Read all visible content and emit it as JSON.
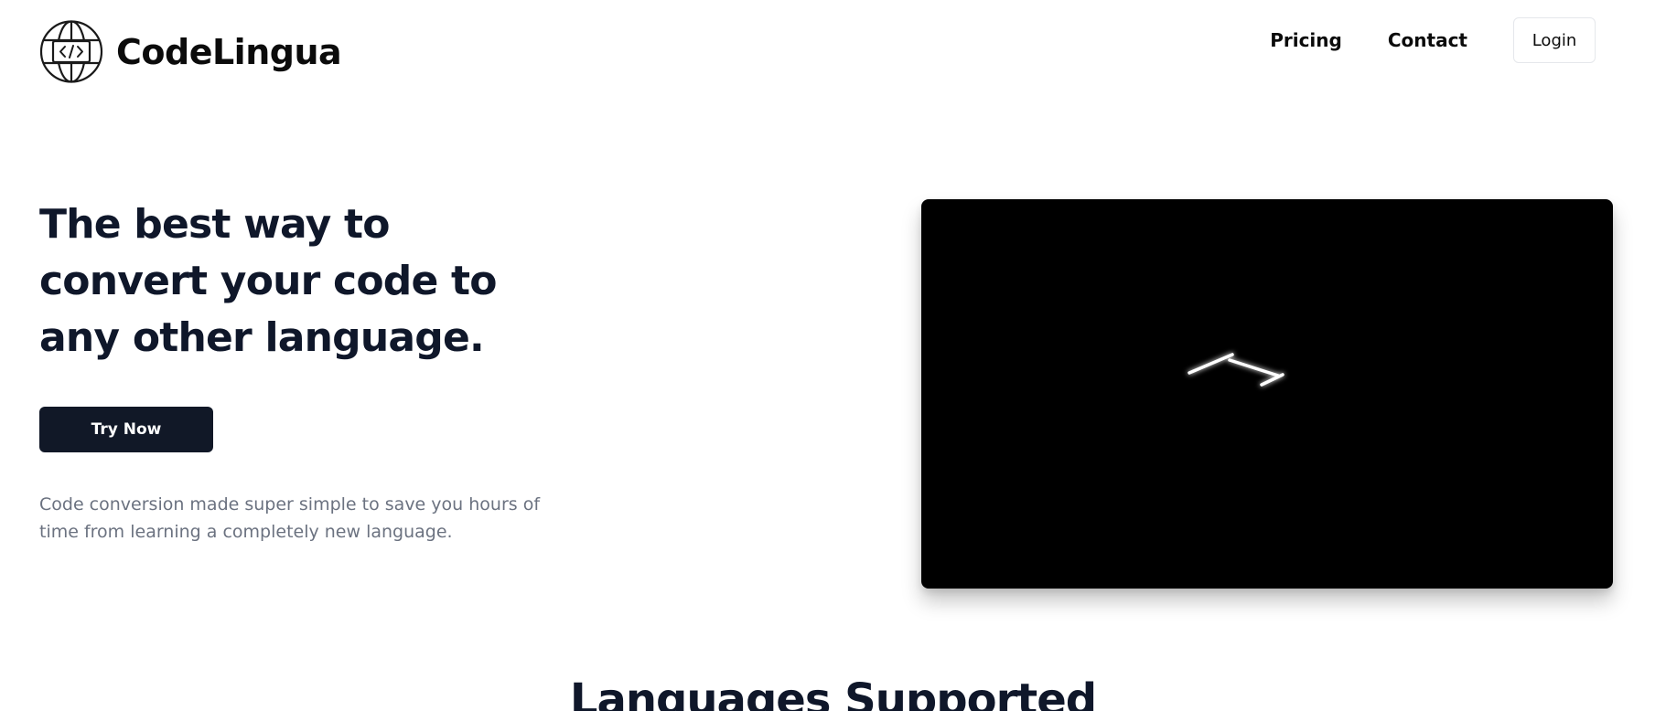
{
  "brand": {
    "name": "CodeLingua",
    "logo_icon": "globe-code-icon"
  },
  "nav": {
    "links": [
      "Pricing",
      "Contact"
    ],
    "login_label": "Login"
  },
  "hero": {
    "title": "The best way to convert your code to any other language.",
    "cta_label": "Try Now",
    "description": "Code conversion made super simple to save you hours of time from learning a completely new language.",
    "media": "video-preview"
  },
  "languages": {
    "heading": "Languages Supported"
  },
  "colors": {
    "text": "#0f172a",
    "cta_background": "#111827",
    "muted_text": "#6b7280",
    "video_background": "#000000"
  }
}
